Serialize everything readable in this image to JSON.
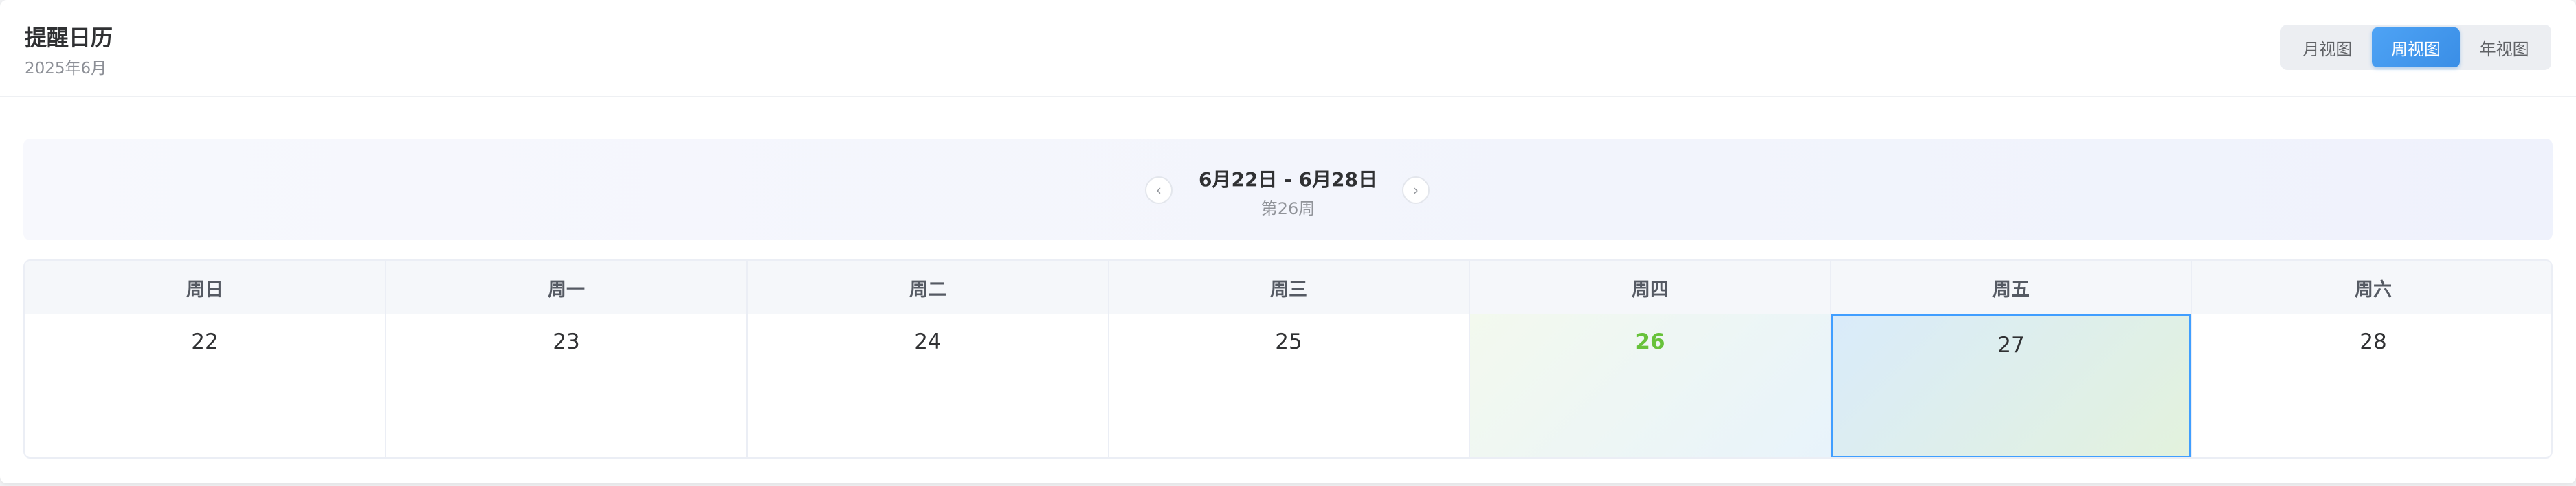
{
  "header": {
    "title": "提醒日历",
    "subtitle": "2025年6月",
    "views": [
      {
        "label": "月视图",
        "active": false
      },
      {
        "label": "周视图",
        "active": true
      },
      {
        "label": "年视图",
        "active": false
      }
    ]
  },
  "week_nav": {
    "prev_icon": "chevron-left-icon",
    "next_icon": "chevron-right-icon",
    "prev_glyph": "‹",
    "next_glyph": "›",
    "range": "6月22日 - 6月28日",
    "week": "第26周"
  },
  "week": {
    "days": [
      {
        "weekday": "周日",
        "date": "22"
      },
      {
        "weekday": "周一",
        "date": "23"
      },
      {
        "weekday": "周二",
        "date": "24"
      },
      {
        "weekday": "周三",
        "date": "25"
      },
      {
        "weekday": "周四",
        "date": "26",
        "today": true
      },
      {
        "weekday": "周五",
        "date": "27",
        "selected": true
      },
      {
        "weekday": "周六",
        "date": "28"
      }
    ]
  },
  "colors": {
    "accent": "#409eff",
    "today_text": "#67c23a"
  }
}
